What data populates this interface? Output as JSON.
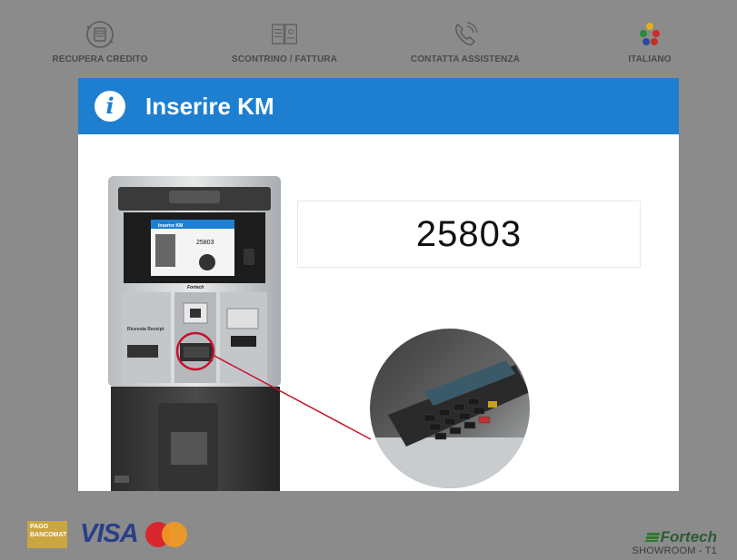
{
  "topbar": {
    "items": [
      {
        "label": "RECUPERA CREDITO",
        "icon": "wallet-recovery-icon"
      },
      {
        "label": "SCONTRINO / FATTURA",
        "icon": "receipt-invoice-icon"
      },
      {
        "label": "CONTATTA ASSISTENZA",
        "icon": "phone-icon"
      },
      {
        "label": "ITALIANO",
        "icon": "flags-icon"
      }
    ]
  },
  "modal": {
    "title": "Inserire KM",
    "km_value": "25803",
    "kiosk_screen_title": "Inserire KM",
    "kiosk_screen_value": "25803",
    "receipt_label": "Ricevuta\nReceipt",
    "kiosk_brand": "Fortech"
  },
  "footer": {
    "pago_label": "PAGO\nBANCOMAT",
    "visa_label": "VISA",
    "brand": "Fortech",
    "site": "SHOWROOM - T1"
  },
  "colors": {
    "header_blue": "#1e7fd0",
    "background": "#8b8b8b",
    "highlight_red": "#c8102e"
  }
}
